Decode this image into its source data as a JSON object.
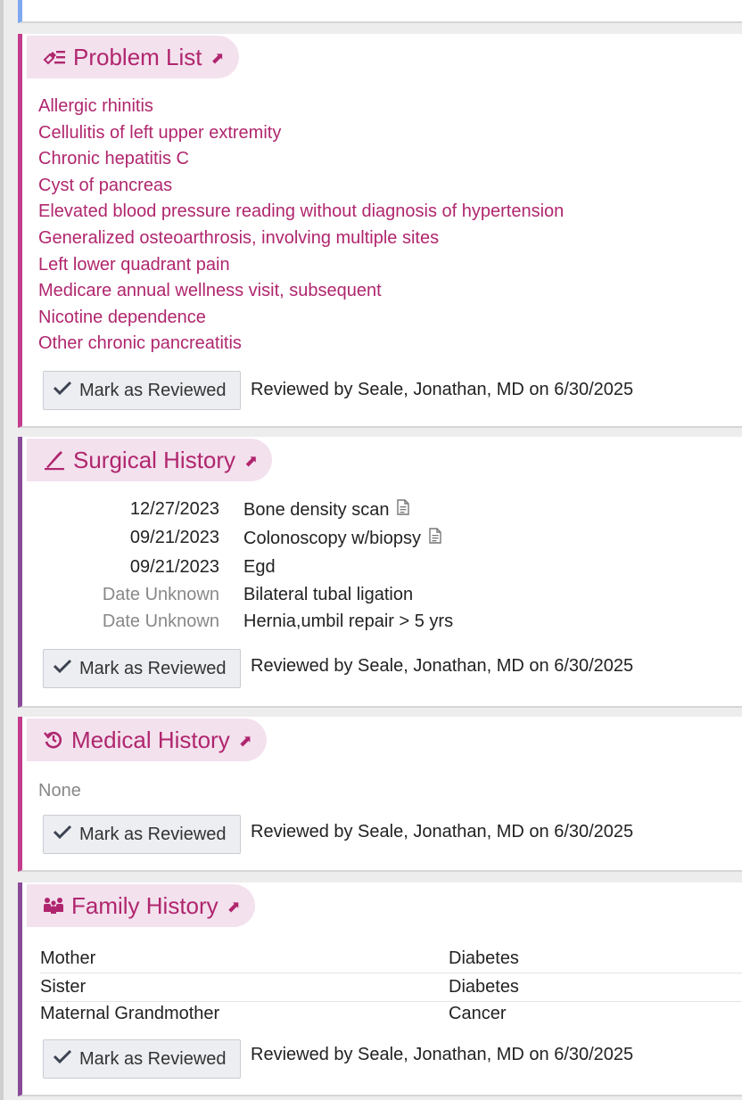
{
  "problem_list": {
    "title": "Problem List",
    "items": [
      "Allergic rhinitis",
      "Cellulitis of left upper extremity",
      "Chronic hepatitis C",
      "Cyst of pancreas",
      "Elevated blood pressure reading without diagnosis of hypertension",
      "Generalized osteoarthrosis, involving multiple sites",
      "Left lower quadrant pain",
      "Medicare annual wellness visit, subsequent",
      "Nicotine dependence",
      "Other chronic pancreatitis"
    ],
    "review_button": "Mark as Reviewed",
    "review_text": "Reviewed by Seale, Jonathan, MD on 6/30/2025"
  },
  "surgical_history": {
    "title": "Surgical History",
    "items": [
      {
        "date": "12/27/2023",
        "procedure": "Bone density scan",
        "has_doc": true
      },
      {
        "date": "09/21/2023",
        "procedure": "Colonoscopy w/biopsy",
        "has_doc": true
      },
      {
        "date": "09/21/2023",
        "procedure": "Egd",
        "has_doc": false
      },
      {
        "date": "Date Unknown",
        "procedure": "Bilateral tubal ligation",
        "has_doc": false
      },
      {
        "date": "Date Unknown",
        "procedure": "Hernia,umbil repair > 5 yrs",
        "has_doc": false
      }
    ],
    "review_button": "Mark as Reviewed",
    "review_text": "Reviewed by Seale, Jonathan, MD on 6/30/2025"
  },
  "medical_history": {
    "title": "Medical History",
    "none_text": "None",
    "review_button": "Mark as Reviewed",
    "review_text": "Reviewed by Seale, Jonathan, MD on 6/30/2025"
  },
  "family_history": {
    "title": "Family History",
    "rows": [
      {
        "relation": "Mother",
        "condition": "Diabetes"
      },
      {
        "relation": "Sister",
        "condition": "Diabetes"
      },
      {
        "relation": "Maternal Grandmother",
        "condition": "Cancer"
      }
    ],
    "review_button": "Mark as Reviewed",
    "review_text": "Reviewed by Seale, Jonathan, MD on 6/30/2025"
  },
  "colors": {
    "accent_pink": "#b0266e",
    "header_bg": "#f3e1ee",
    "border_pink": "#c43c8c",
    "border_purple": "#8a4a9a"
  }
}
